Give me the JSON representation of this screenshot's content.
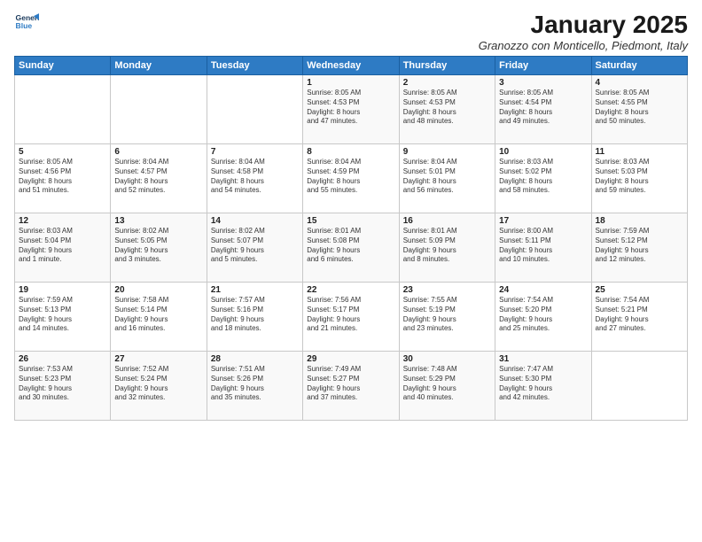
{
  "logo": {
    "line1": "General",
    "line2": "Blue"
  },
  "title": "January 2025",
  "location": "Granozzo con Monticello, Piedmont, Italy",
  "days_of_week": [
    "Sunday",
    "Monday",
    "Tuesday",
    "Wednesday",
    "Thursday",
    "Friday",
    "Saturday"
  ],
  "weeks": [
    [
      {
        "day": "",
        "content": ""
      },
      {
        "day": "",
        "content": ""
      },
      {
        "day": "",
        "content": ""
      },
      {
        "day": "1",
        "content": "Sunrise: 8:05 AM\nSunset: 4:53 PM\nDaylight: 8 hours\nand 47 minutes."
      },
      {
        "day": "2",
        "content": "Sunrise: 8:05 AM\nSunset: 4:53 PM\nDaylight: 8 hours\nand 48 minutes."
      },
      {
        "day": "3",
        "content": "Sunrise: 8:05 AM\nSunset: 4:54 PM\nDaylight: 8 hours\nand 49 minutes."
      },
      {
        "day": "4",
        "content": "Sunrise: 8:05 AM\nSunset: 4:55 PM\nDaylight: 8 hours\nand 50 minutes."
      }
    ],
    [
      {
        "day": "5",
        "content": "Sunrise: 8:05 AM\nSunset: 4:56 PM\nDaylight: 8 hours\nand 51 minutes."
      },
      {
        "day": "6",
        "content": "Sunrise: 8:04 AM\nSunset: 4:57 PM\nDaylight: 8 hours\nand 52 minutes."
      },
      {
        "day": "7",
        "content": "Sunrise: 8:04 AM\nSunset: 4:58 PM\nDaylight: 8 hours\nand 54 minutes."
      },
      {
        "day": "8",
        "content": "Sunrise: 8:04 AM\nSunset: 4:59 PM\nDaylight: 8 hours\nand 55 minutes."
      },
      {
        "day": "9",
        "content": "Sunrise: 8:04 AM\nSunset: 5:01 PM\nDaylight: 8 hours\nand 56 minutes."
      },
      {
        "day": "10",
        "content": "Sunrise: 8:03 AM\nSunset: 5:02 PM\nDaylight: 8 hours\nand 58 minutes."
      },
      {
        "day": "11",
        "content": "Sunrise: 8:03 AM\nSunset: 5:03 PM\nDaylight: 8 hours\nand 59 minutes."
      }
    ],
    [
      {
        "day": "12",
        "content": "Sunrise: 8:03 AM\nSunset: 5:04 PM\nDaylight: 9 hours\nand 1 minute."
      },
      {
        "day": "13",
        "content": "Sunrise: 8:02 AM\nSunset: 5:05 PM\nDaylight: 9 hours\nand 3 minutes."
      },
      {
        "day": "14",
        "content": "Sunrise: 8:02 AM\nSunset: 5:07 PM\nDaylight: 9 hours\nand 5 minutes."
      },
      {
        "day": "15",
        "content": "Sunrise: 8:01 AM\nSunset: 5:08 PM\nDaylight: 9 hours\nand 6 minutes."
      },
      {
        "day": "16",
        "content": "Sunrise: 8:01 AM\nSunset: 5:09 PM\nDaylight: 9 hours\nand 8 minutes."
      },
      {
        "day": "17",
        "content": "Sunrise: 8:00 AM\nSunset: 5:11 PM\nDaylight: 9 hours\nand 10 minutes."
      },
      {
        "day": "18",
        "content": "Sunrise: 7:59 AM\nSunset: 5:12 PM\nDaylight: 9 hours\nand 12 minutes."
      }
    ],
    [
      {
        "day": "19",
        "content": "Sunrise: 7:59 AM\nSunset: 5:13 PM\nDaylight: 9 hours\nand 14 minutes."
      },
      {
        "day": "20",
        "content": "Sunrise: 7:58 AM\nSunset: 5:14 PM\nDaylight: 9 hours\nand 16 minutes."
      },
      {
        "day": "21",
        "content": "Sunrise: 7:57 AM\nSunset: 5:16 PM\nDaylight: 9 hours\nand 18 minutes."
      },
      {
        "day": "22",
        "content": "Sunrise: 7:56 AM\nSunset: 5:17 PM\nDaylight: 9 hours\nand 21 minutes."
      },
      {
        "day": "23",
        "content": "Sunrise: 7:55 AM\nSunset: 5:19 PM\nDaylight: 9 hours\nand 23 minutes."
      },
      {
        "day": "24",
        "content": "Sunrise: 7:54 AM\nSunset: 5:20 PM\nDaylight: 9 hours\nand 25 minutes."
      },
      {
        "day": "25",
        "content": "Sunrise: 7:54 AM\nSunset: 5:21 PM\nDaylight: 9 hours\nand 27 minutes."
      }
    ],
    [
      {
        "day": "26",
        "content": "Sunrise: 7:53 AM\nSunset: 5:23 PM\nDaylight: 9 hours\nand 30 minutes."
      },
      {
        "day": "27",
        "content": "Sunrise: 7:52 AM\nSunset: 5:24 PM\nDaylight: 9 hours\nand 32 minutes."
      },
      {
        "day": "28",
        "content": "Sunrise: 7:51 AM\nSunset: 5:26 PM\nDaylight: 9 hours\nand 35 minutes."
      },
      {
        "day": "29",
        "content": "Sunrise: 7:49 AM\nSunset: 5:27 PM\nDaylight: 9 hours\nand 37 minutes."
      },
      {
        "day": "30",
        "content": "Sunrise: 7:48 AM\nSunset: 5:29 PM\nDaylight: 9 hours\nand 40 minutes."
      },
      {
        "day": "31",
        "content": "Sunrise: 7:47 AM\nSunset: 5:30 PM\nDaylight: 9 hours\nand 42 minutes."
      },
      {
        "day": "",
        "content": ""
      }
    ]
  ]
}
